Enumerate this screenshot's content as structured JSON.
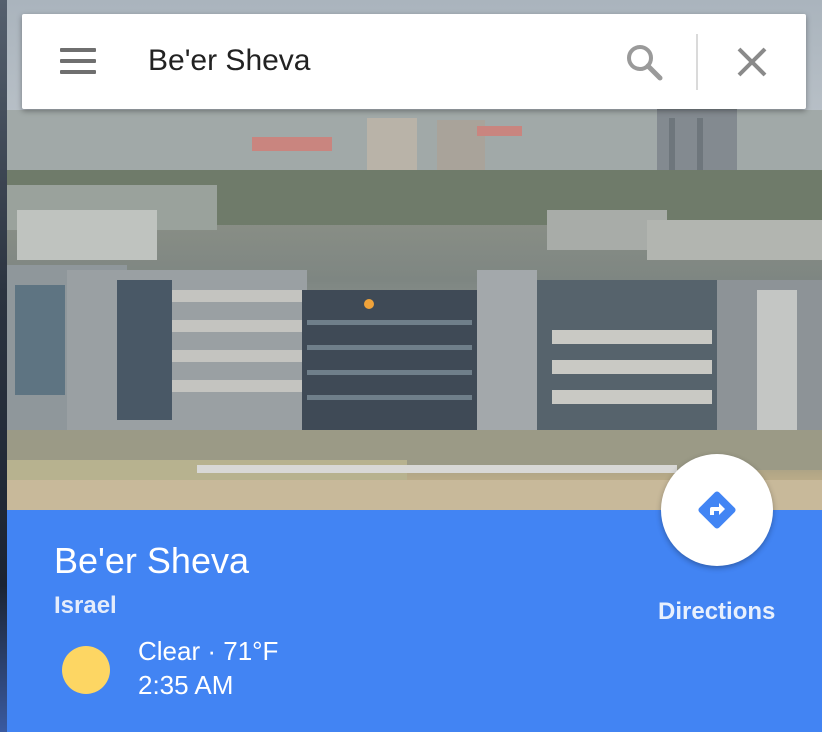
{
  "search": {
    "value": "Be'er Sheva",
    "menu_icon": "hamburger-menu-icon",
    "search_icon": "search-icon",
    "close_icon": "close-icon"
  },
  "hero": {
    "image": "city-photo"
  },
  "place": {
    "name": "Be'er Sheva",
    "country": "Israel"
  },
  "weather": {
    "icon": "sun-icon",
    "summary": "Clear · 71°F",
    "time": "2:35 AM"
  },
  "directions": {
    "label": "Directions",
    "icon": "directions-icon"
  },
  "colors": {
    "panel": "#4284f3",
    "sun": "#fdd663",
    "directions_icon": "#4285f4"
  }
}
